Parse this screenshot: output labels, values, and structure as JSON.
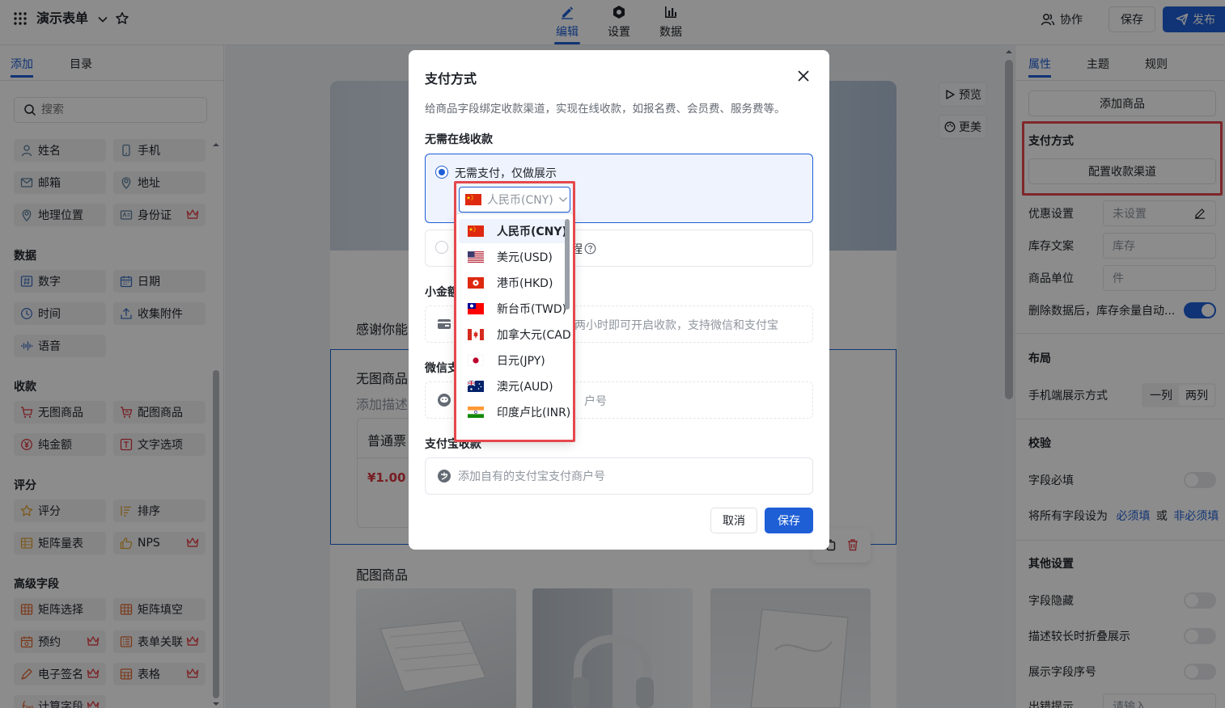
{
  "topbar": {
    "form_title": "演示表单",
    "tabs": [
      {
        "label": "编辑",
        "icon": "pen-icon",
        "active": true
      },
      {
        "label": "设置",
        "icon": "gear-icon",
        "active": false
      },
      {
        "label": "数据",
        "icon": "bar-chart-icon",
        "active": false
      }
    ],
    "collaborate_label": "协作",
    "save_label": "保存",
    "publish_label": "发布"
  },
  "left_panel": {
    "tabs": [
      "添加",
      "目录"
    ],
    "search_placeholder": "搜索",
    "sections": [
      {
        "title": "",
        "items": [
          {
            "label": "姓名",
            "icon": "person-icon",
            "premium": false
          },
          {
            "label": "手机",
            "icon": "phone-icon",
            "premium": false
          },
          {
            "label": "邮箱",
            "icon": "mail-icon",
            "premium": false
          },
          {
            "label": "地址",
            "icon": "location-icon",
            "premium": false
          },
          {
            "label": "地理位置",
            "icon": "map-pin-icon",
            "premium": false
          },
          {
            "label": "身份证",
            "icon": "id-card-icon",
            "premium": true
          }
        ]
      },
      {
        "title": "数据",
        "items": [
          {
            "label": "数字",
            "icon": "number-icon",
            "premium": false
          },
          {
            "label": "日期",
            "icon": "calendar-icon",
            "premium": false
          },
          {
            "label": "时间",
            "icon": "clock-icon",
            "premium": false
          },
          {
            "label": "收集附件",
            "icon": "upload-icon",
            "premium": false
          },
          {
            "label": "语音",
            "icon": "voice-icon",
            "premium": false
          }
        ]
      },
      {
        "title": "收款",
        "items": [
          {
            "label": "无图商品",
            "icon": "cart-icon",
            "premium": false
          },
          {
            "label": "配图商品",
            "icon": "cart-image-icon",
            "premium": false
          },
          {
            "label": "纯金额",
            "icon": "yen-icon",
            "premium": false
          },
          {
            "label": "文字选项",
            "icon": "text-option-icon",
            "premium": false
          }
        ]
      },
      {
        "title": "评分",
        "items": [
          {
            "label": "评分",
            "icon": "star-icon",
            "premium": false
          },
          {
            "label": "排序",
            "icon": "sort-icon",
            "premium": false
          },
          {
            "label": "矩阵量表",
            "icon": "matrix-scale-icon",
            "premium": false
          },
          {
            "label": "NPS",
            "icon": "thumb-up-icon",
            "premium": true
          }
        ]
      },
      {
        "title": "高级字段",
        "items": [
          {
            "label": "矩阵选择",
            "icon": "matrix-select-icon",
            "premium": false
          },
          {
            "label": "矩阵填空",
            "icon": "matrix-fill-icon",
            "premium": false
          },
          {
            "label": "预约",
            "icon": "booking-icon",
            "premium": true
          },
          {
            "label": "表单关联",
            "icon": "form-link-icon",
            "premium": true
          },
          {
            "label": "电子签名",
            "icon": "signature-icon",
            "premium": true
          },
          {
            "label": "表格",
            "icon": "table-icon",
            "premium": true
          },
          {
            "label": "计算字段",
            "icon": "formula-icon",
            "premium": true
          }
        ]
      }
    ]
  },
  "canvas": {
    "preview_label": "预览",
    "beautify_label": "更美",
    "thanks_text": "感谢你能",
    "product_block_title": "无图商品",
    "product_block_desc": "添加描述",
    "ticket_name": "普通票",
    "ticket_price": "¥1.00",
    "image_products_title": "配图商品"
  },
  "right_panel": {
    "tabs": [
      "属性",
      "主题",
      "规则"
    ],
    "add_product_label": "添加商品",
    "payment_title": "支付方式",
    "configure_channel_label": "配置收款渠道",
    "discount_label": "优惠设置",
    "discount_value": "未设置",
    "stock_text_label": "库存文案",
    "stock_text_placeholder": "库存",
    "unit_label": "商品单位",
    "unit_placeholder": "件",
    "delete_restock_label": "删除数据后，库存余量自动...",
    "delete_restock_on": true,
    "layout_title": "布局",
    "mobile_display_label": "手机端展示方式",
    "layout_options": [
      "一列",
      "两列"
    ],
    "validation_title": "校验",
    "required_label": "字段必填",
    "required_on": false,
    "set_all_prefix": "将所有字段设为",
    "set_all_required": "必须填",
    "set_all_or": "或",
    "set_all_optional": "非必须填",
    "other_title": "其他设置",
    "hidden_label": "字段隐藏",
    "hidden_on": false,
    "collapse_label": "描述较长时折叠展示",
    "collapse_on": false,
    "index_label": "展示字段序号",
    "index_on": false,
    "error_label": "出错提示",
    "error_placeholder": "请输入"
  },
  "modal": {
    "title": "支付方式",
    "description": "给商品字段绑定收款渠道，实现在线收款，如报名费、会员费、服务费等。",
    "no_online_title": "无需在线收款",
    "no_pay_option": "无需支付，仅做展示",
    "currency_selected": "人民币(CNY)",
    "second_option_text": "程",
    "small_amount_title": "小金额",
    "small_amount_text": "决两小时即可开启收款，支持微信和支付宝",
    "wechat_title": "微信支",
    "wechat_text": "户号",
    "alipay_title": "支付宝收款",
    "alipay_placeholder": "添加自有的支付宝支付商户号",
    "cancel_label": "取消",
    "save_label": "保存"
  },
  "currency_dropdown": {
    "items": [
      {
        "label": "人民币(CNY)",
        "flag": "china-flag-icon",
        "selected": true
      },
      {
        "label": "美元(USD)",
        "flag": "us-flag-icon",
        "selected": false
      },
      {
        "label": "港币(HKD)",
        "flag": "hk-flag-icon",
        "selected": false
      },
      {
        "label": "新台币(TWD)",
        "flag": "twd-flag-icon",
        "selected": false
      },
      {
        "label": "加拿大元(CAD",
        "flag": "canada-flag-icon",
        "selected": false
      },
      {
        "label": "日元(JPY)",
        "flag": "japan-flag-icon",
        "selected": false
      },
      {
        "label": "澳元(AUD)",
        "flag": "australia-flag-icon",
        "selected": false
      },
      {
        "label": "印度卢比(INR)",
        "flag": "india-flag-icon",
        "selected": false
      }
    ]
  },
  "colors": {
    "accent": "#1e5fd6",
    "highlight_red": "#e5484d",
    "premium_red": "#e5484d"
  }
}
